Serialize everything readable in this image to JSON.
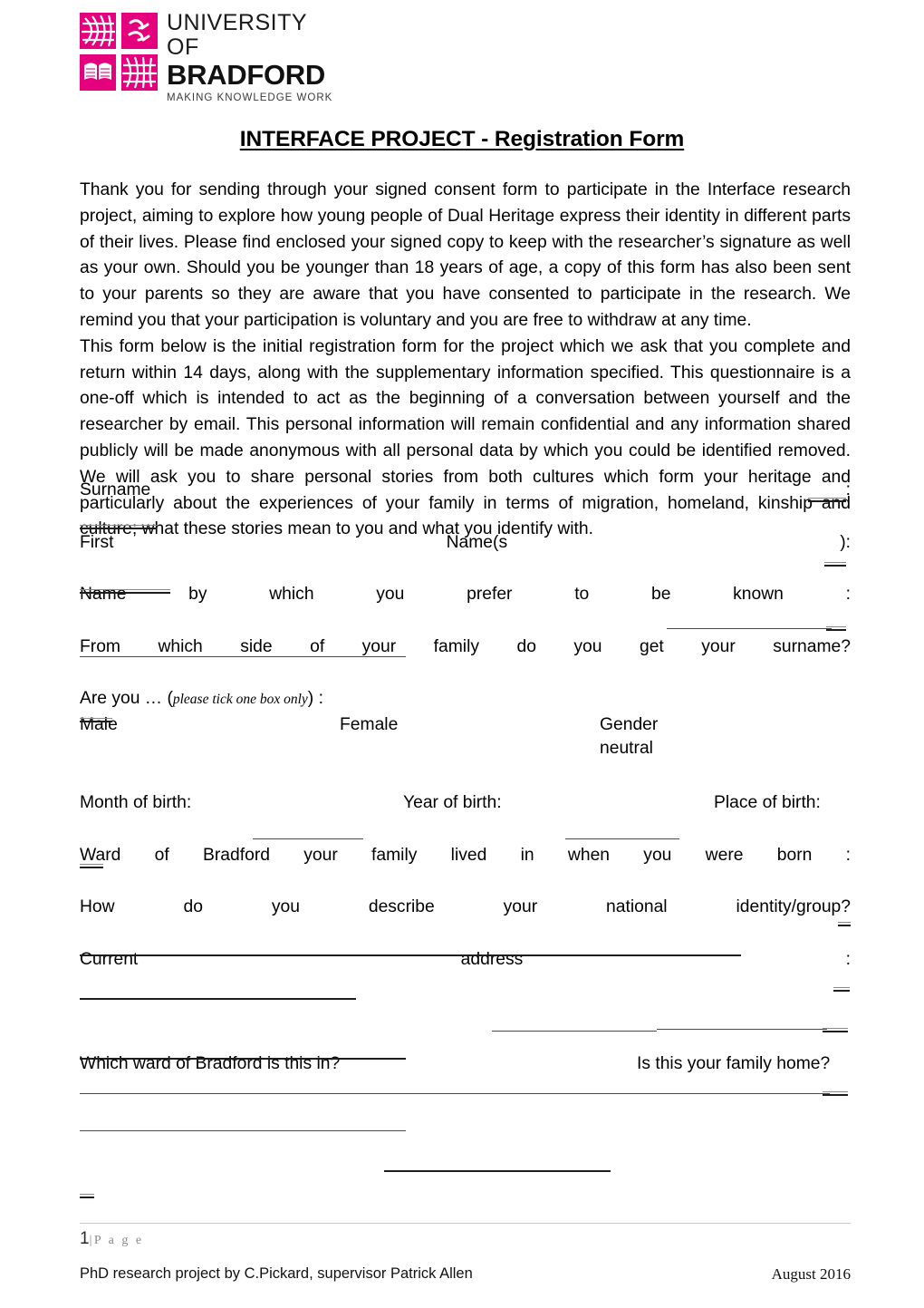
{
  "logo": {
    "university_line": "UNIVERSITY OF",
    "name_line": "BRADFORD",
    "tagline": "MAKING KNOWLEDGE WORK",
    "brand_color": "#E5007D"
  },
  "title": "INTERFACE PROJECT - Registration Form",
  "intro": {
    "paragraph_1": "Thank you for sending through your signed consent form to participate in the Interface research project, aiming to explore how young people of Dual Heritage express their identity in different parts of their lives. Please find enclosed your signed copy to keep with the researcher’s signature as well as your own. Should you be younger than 18 years of age, a copy of this form has also been sent to your parents so they are aware that you have consented to participate in the research. We remind you that your participation is voluntary and you are free to withdraw at any time.",
    "paragraph_2": "This form below is the initial registration form for the project which we ask that you complete and return within 14 days, along with the supplementary information specified. This questionnaire is a one-off which is intended to act as the beginning of a conversation between yourself and the researcher by email. This personal information will remain confidential and any information shared publicly will be made anonymous with all personal data by which you could be identified removed. We will ask you to share personal stories from both cultures which form your heritage and particularly about the experiences of your family in terms of migration, homeland, kinship and culture; what these stories mean to you and what you identify with."
  },
  "fields": {
    "surname": "Surname                          :",
    "first_names": "First                     Name(s                     ):",
    "preferred_name": "Name   by   which   you   prefer   to   be   known   :",
    "surname_side": "From     which     side     of     your     family     do     you     get     your     surname?",
    "gender_question": "Are you … (",
    "gender_note": "please tick one box only",
    "gender_question_end": ") :",
    "gender_male": "Male",
    "gender_female": "Female",
    "gender_neutral": "Gender neutral",
    "month_of_birth": "Month  of  birth:",
    "year_of_birth": "Year  of  birth:",
    "place_of_birth": "Place  of  birth:",
    "ward_born": "Ward    of    Bradford    your    family    lived    in    when    you    were    born    :",
    "national_identity": "How     do     you     describe     your     national     identity/group?",
    "current_address": "Current            address            :",
    "which_ward": "Which ward of Bradford is this in?",
    "family_home": "Is this your family home?"
  },
  "footer": {
    "page_number": "1",
    "page_word": "|P a g e",
    "credit": "PhD research project by C.Pickard, supervisor Patrick Allen",
    "date": "August 2016"
  }
}
